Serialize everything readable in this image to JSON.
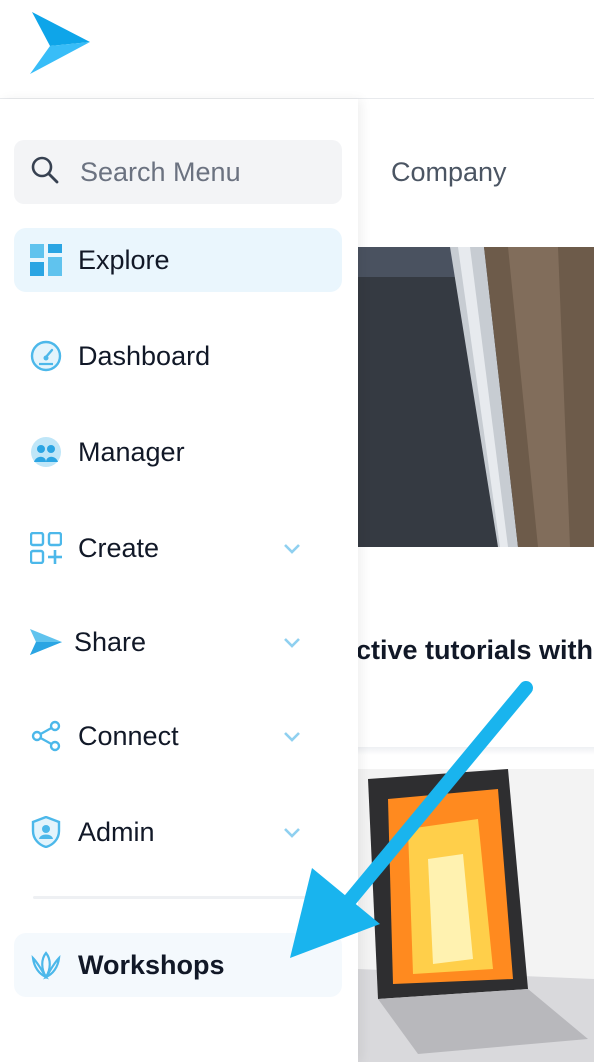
{
  "header": {
    "logo_icon": "paper-plane-logo-icon",
    "brand_color": "#1aa8e8"
  },
  "background": {
    "tab_label": "Company",
    "headline": "ctive tutorials with"
  },
  "sidebar": {
    "search": {
      "placeholder": "Search Menu",
      "icon": "search-icon"
    },
    "items": [
      {
        "label": "Explore",
        "icon": "grid-icon",
        "active": true
      },
      {
        "label": "Dashboard",
        "icon": "gauge-icon"
      },
      {
        "label": "Manager",
        "icon": "users-icon"
      },
      {
        "label": "Create",
        "icon": "add-grid-icon",
        "expandable": true
      },
      {
        "label": "Share",
        "icon": "send-icon",
        "expandable": true
      },
      {
        "label": "Connect",
        "icon": "share-nodes-icon",
        "expandable": true
      },
      {
        "label": "Admin",
        "icon": "shield-user-icon",
        "expandable": true
      }
    ],
    "workshops": {
      "label": "Workshops",
      "icon": "lotus-icon"
    }
  },
  "annotation": {
    "arrow_color": "#19b4ee",
    "points_to": "Workshops"
  }
}
